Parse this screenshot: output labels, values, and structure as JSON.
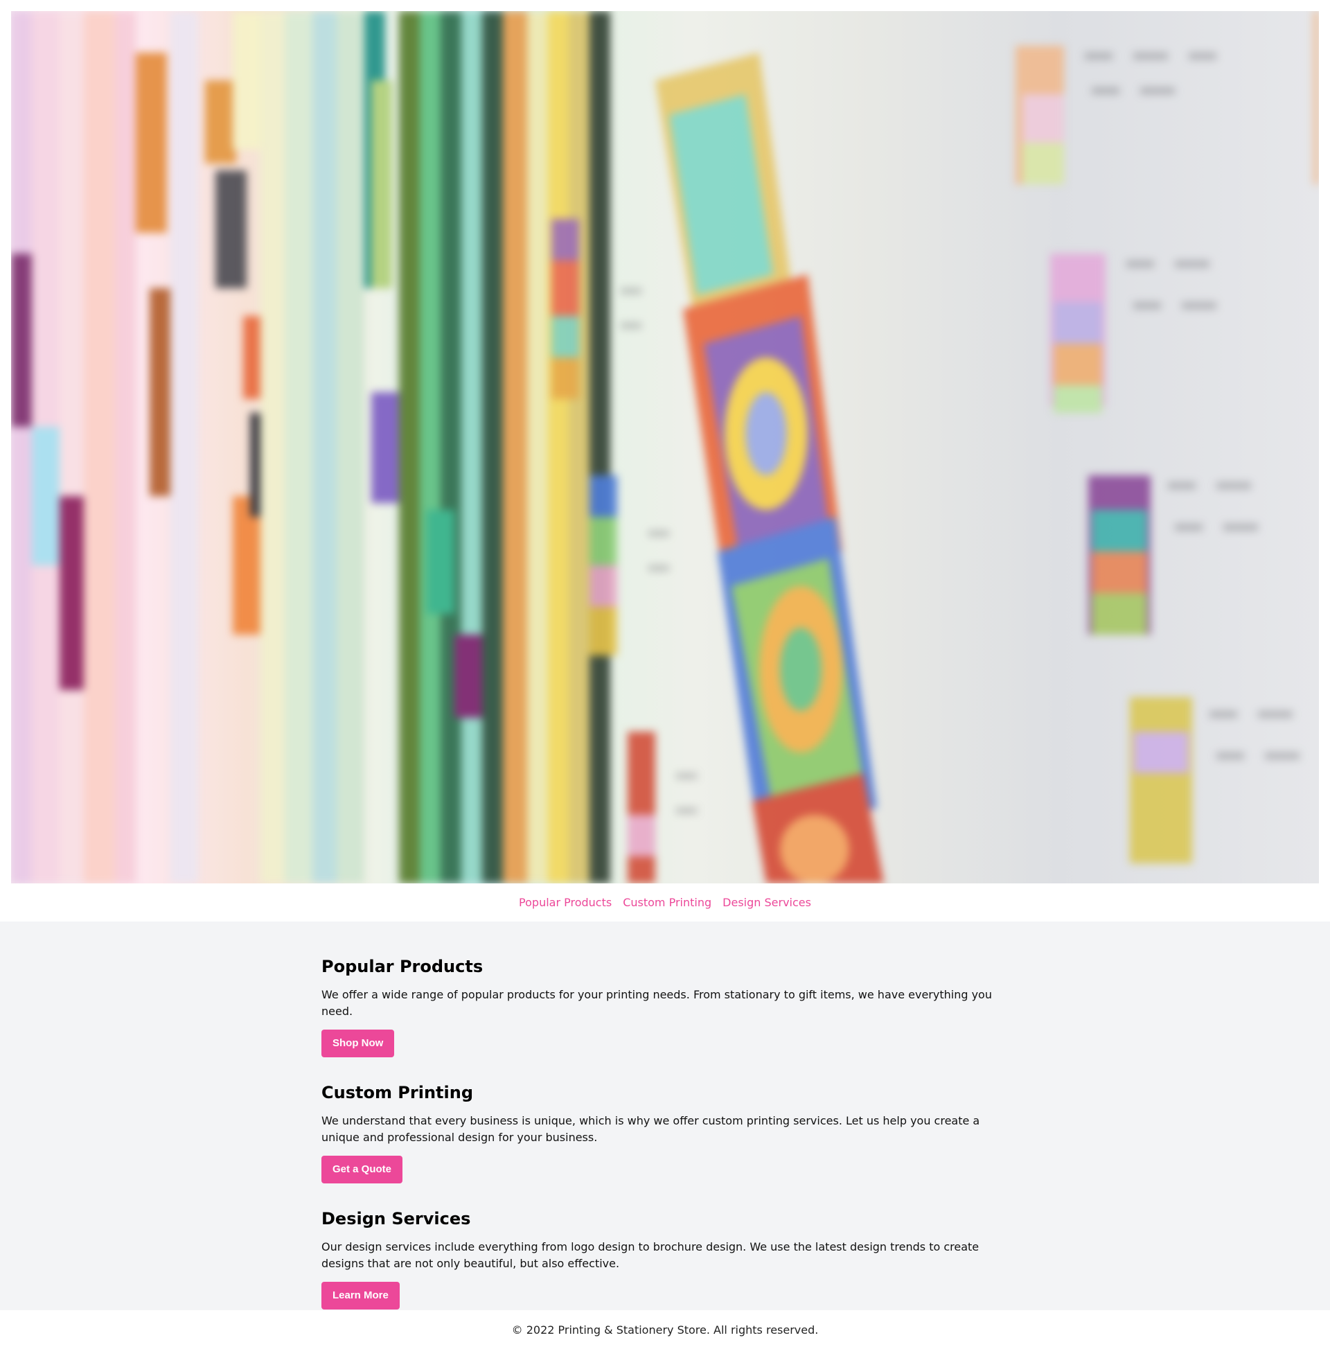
{
  "hero": {
    "image_icon": "color-swatch-photo-icon"
  },
  "nav": {
    "links": [
      {
        "label": "Popular Products"
      },
      {
        "label": "Custom Printing"
      },
      {
        "label": "Design Services"
      }
    ]
  },
  "sections": [
    {
      "title": "Popular Products",
      "text": "We offer a wide range of popular products for your printing needs. From stationary to gift items, we have everything you need.",
      "button": "Shop Now"
    },
    {
      "title": "Custom Printing",
      "text": "We understand that every business is unique, which is why we offer custom printing services. Let us help you create a unique and professional design for your business.",
      "button": "Get a Quote"
    },
    {
      "title": "Design Services",
      "text": "Our design services include everything from logo design to brochure design. We use the latest design trends to create designs that are not only beautiful, but also effective.",
      "button": "Learn More"
    }
  ],
  "footer": {
    "text": "© 2022 Printing & Stationery Store. All rights reserved."
  },
  "colors": {
    "accent": "#ec4899",
    "main_bg": "#f3f4f6"
  }
}
